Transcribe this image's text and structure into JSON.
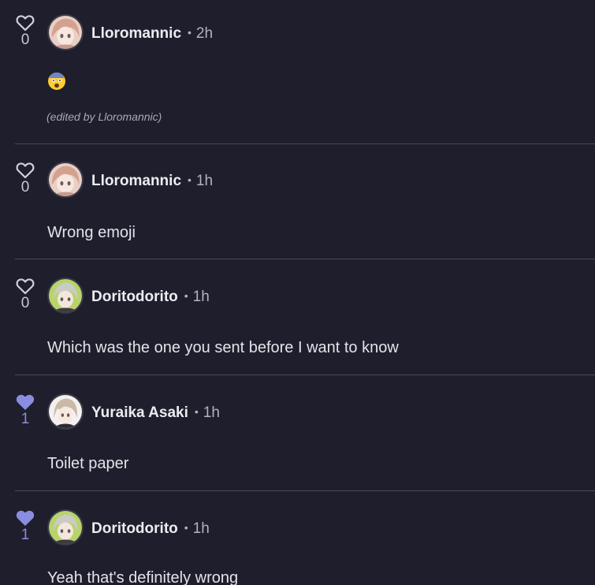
{
  "colors": {
    "background": "#1f1e2c",
    "like_accent": "#8a8ee0",
    "divider": "#4a495a"
  },
  "comments": [
    {
      "likes": "0",
      "liked": false,
      "username": "Lloromannic",
      "time": "2h",
      "body": "",
      "emoji_icon": "fearful-face-emoji-icon",
      "edited_note": "(edited by Lloromannic)",
      "avatar": "pink-hair-avatar"
    },
    {
      "likes": "0",
      "liked": false,
      "username": "Lloromannic",
      "time": "1h",
      "body": "Wrong emoji",
      "avatar": "pink-hair-avatar"
    },
    {
      "likes": "0",
      "liked": false,
      "username": "Doritodorito",
      "time": "1h",
      "body": "Which was the one you sent before I want to know",
      "avatar": "green-bg-avatar"
    },
    {
      "likes": "1",
      "liked": true,
      "username": "Yuraika Asaki",
      "time": "1h",
      "body": "Toilet paper",
      "avatar": "white-bg-avatar"
    },
    {
      "likes": "1",
      "liked": true,
      "username": "Doritodorito",
      "time": "1h",
      "body": "Yeah that's definitely wrong",
      "avatar": "green-bg-avatar"
    }
  ],
  "separator": "•"
}
